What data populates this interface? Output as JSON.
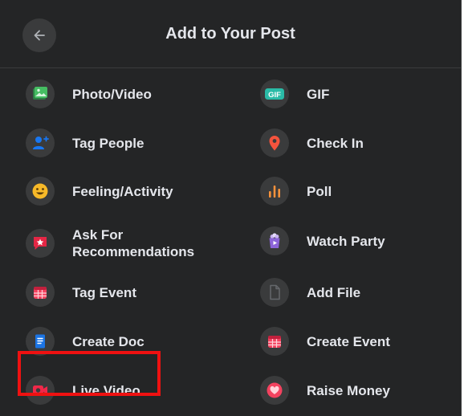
{
  "header": {
    "title": "Add to Your Post",
    "back_icon": "back-arrow-icon"
  },
  "colors": {
    "background": "#242526",
    "text": "#e4e6eb",
    "icon_bg": "#3a3b3c",
    "highlight": "#ef1111"
  },
  "left_items": [
    {
      "label": "Photo/Video",
      "icon": "photo-video-icon",
      "color": "#45bd62"
    },
    {
      "label": "Tag People",
      "icon": "tag-people-icon",
      "color": "#1877f2"
    },
    {
      "label": "Feeling/Activity",
      "icon": "feeling-activity-icon",
      "color": "#f7b928"
    },
    {
      "label": "Ask For Recommendations",
      "icon": "ask-recommendations-icon",
      "color": "#e42645"
    },
    {
      "label": "Tag Event",
      "icon": "tag-event-icon",
      "color": "#f3425f"
    },
    {
      "label": "Create Doc",
      "icon": "create-doc-icon",
      "color": "#1b74e4"
    },
    {
      "label": "Live Video",
      "icon": "live-video-icon",
      "color": "#f02849"
    }
  ],
  "right_items": [
    {
      "label": "GIF",
      "icon": "gif-icon",
      "color": "#2abba7"
    },
    {
      "label": "Check In",
      "icon": "check-in-icon",
      "color": "#f5533d"
    },
    {
      "label": "Poll",
      "icon": "poll-icon",
      "color": "#f7923b"
    },
    {
      "label": "Watch Party",
      "icon": "watch-party-icon",
      "color": "#8c64d8"
    },
    {
      "label": "Add File",
      "icon": "add-file-icon",
      "color": "#65676b"
    },
    {
      "label": "Create Event",
      "icon": "create-event-icon",
      "color": "#f3425f"
    },
    {
      "label": "Raise Money",
      "icon": "raise-money-icon",
      "color": "#f3425f"
    }
  ]
}
